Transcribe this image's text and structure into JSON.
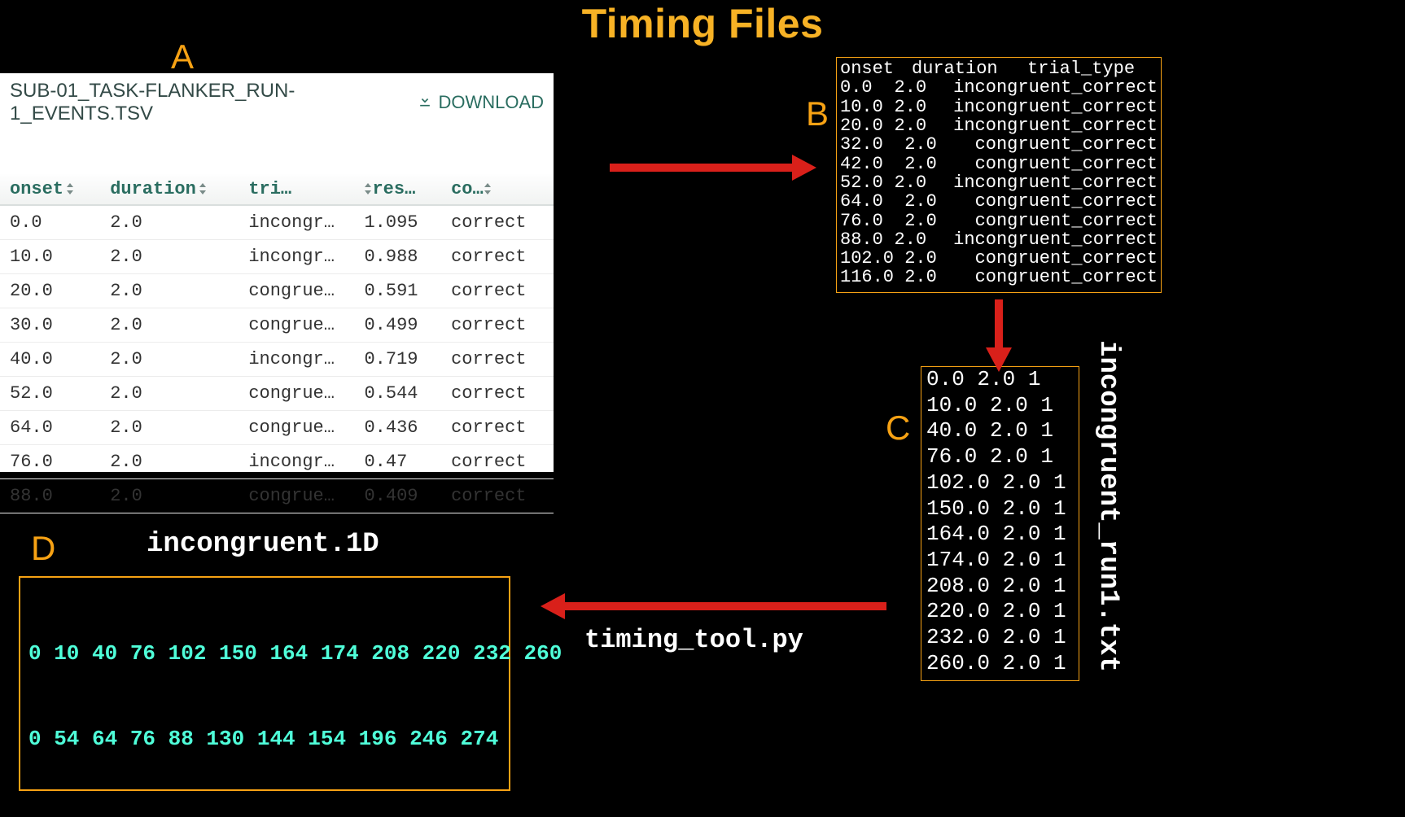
{
  "title": "Timing Files",
  "labels": {
    "A": "A",
    "B": "B",
    "C": "C",
    "D": "D"
  },
  "panelA": {
    "filename": "SUB-01_TASK-FLANKER_RUN-1_EVENTS.TSV",
    "download_label": "DOWNLOAD",
    "headers": {
      "onset": "onset",
      "duration": "duration",
      "tri": "tri…",
      "res": "res…",
      "cor": "co…"
    },
    "rows": [
      {
        "onset": "0.0",
        "duration": "2.0",
        "tri": "incongrue…",
        "res": "1.095",
        "cor": "correct"
      },
      {
        "onset": "10.0",
        "duration": "2.0",
        "tri": "incongrue…",
        "res": "0.988",
        "cor": "correct"
      },
      {
        "onset": "20.0",
        "duration": "2.0",
        "tri": "congruent…",
        "res": "0.591",
        "cor": "correct"
      },
      {
        "onset": "30.0",
        "duration": "2.0",
        "tri": "congruent…",
        "res": "0.499",
        "cor": "correct"
      },
      {
        "onset": "40.0",
        "duration": "2.0",
        "tri": "incongrue…",
        "res": "0.719",
        "cor": "correct"
      },
      {
        "onset": "52.0",
        "duration": "2.0",
        "tri": "congruent…",
        "res": "0.544",
        "cor": "correct"
      },
      {
        "onset": "64.0",
        "duration": "2.0",
        "tri": "congruent…",
        "res": "0.436",
        "cor": "correct"
      },
      {
        "onset": "76.0",
        "duration": "2.0",
        "tri": "incongrue…",
        "res": "0.47",
        "cor": "correct"
      },
      {
        "onset": "88.0",
        "duration": "2.0",
        "tri": "congruent…",
        "res": "0.409",
        "cor": "correct"
      }
    ]
  },
  "panelB": {
    "headers": {
      "onset": "onset",
      "duration": "duration",
      "trial_type": "trial_type"
    },
    "rows": [
      {
        "onset": "0.0",
        "duration": "2.0",
        "trial_type": "incongruent_correct"
      },
      {
        "onset": "10.0",
        "duration": "2.0",
        "trial_type": "incongruent_correct"
      },
      {
        "onset": "20.0",
        "duration": "2.0",
        "trial_type": "incongruent_correct"
      },
      {
        "onset": "32.0",
        "duration": "2.0",
        "trial_type": "congruent_correct"
      },
      {
        "onset": "42.0",
        "duration": "2.0",
        "trial_type": "congruent_correct"
      },
      {
        "onset": "52.0",
        "duration": "2.0",
        "trial_type": "incongruent_correct"
      },
      {
        "onset": "64.0",
        "duration": "2.0",
        "trial_type": "congruent_correct"
      },
      {
        "onset": "76.0",
        "duration": "2.0",
        "trial_type": "congruent_correct"
      },
      {
        "onset": "88.0",
        "duration": "2.0",
        "trial_type": "incongruent_correct"
      },
      {
        "onset": "102.0",
        "duration": "2.0",
        "trial_type": "congruent_correct"
      },
      {
        "onset": "116.0",
        "duration": "2.0",
        "trial_type": "congruent_correct"
      }
    ]
  },
  "panelC": {
    "filename": "incongruent_run1.txt",
    "rows": [
      "0.0 2.0 1",
      "10.0 2.0 1",
      "40.0 2.0 1",
      "76.0 2.0 1",
      "102.0 2.0 1",
      "150.0 2.0 1",
      "164.0 2.0 1",
      "174.0 2.0 1",
      "208.0 2.0 1",
      "220.0 2.0 1",
      "232.0 2.0 1",
      "260.0 2.0 1"
    ]
  },
  "panelD": {
    "filename": "incongruent.1D",
    "line1": "0 10 40 76 102 150 164 174 208 220 232 260",
    "line2": "0 54 64 76 88 130 144 154 196 246 274"
  },
  "timing_tool": "timing_tool.py"
}
